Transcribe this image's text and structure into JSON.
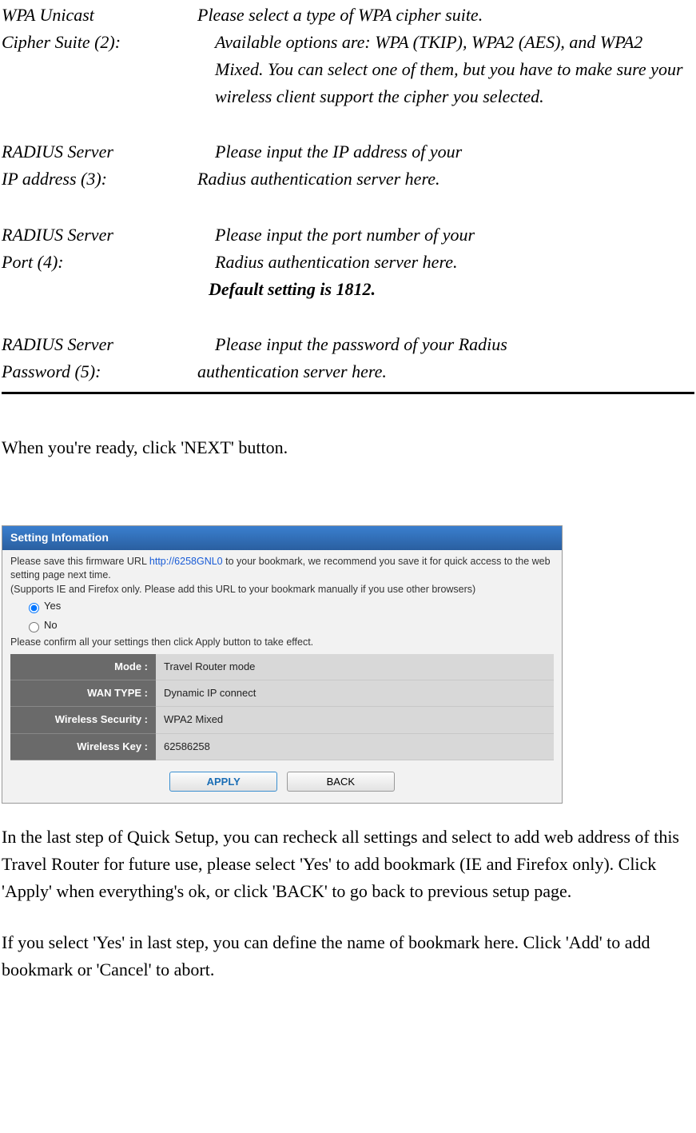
{
  "definitions": {
    "item1": {
      "term_line1": "WPA Unicast",
      "term_line2": "Cipher Suite (2):",
      "desc_line1": "Please select a type of WPA cipher suite.",
      "desc_line2": "Available options are: WPA (TKIP), WPA2 (AES), and WPA2 Mixed. You can select one of them, but you have to make sure your wireless client support the cipher you selected."
    },
    "item2": {
      "term_line1": "RADIUS Server",
      "term_line2": "IP address (3):",
      "desc_line1": "Please input the IP address of your",
      "desc_line2": "Radius authentication server here."
    },
    "item3": {
      "term_line1": "RADIUS Server",
      "term_line2": "Port (4):",
      "desc_line1": "Please input the port number of your",
      "desc_line2": "Radius authentication server here.",
      "bold_line": "Default setting is 1812."
    },
    "item4": {
      "term_line1": "RADIUS Server",
      "term_line2": "Password (5):",
      "desc_line1": "Please input the password of your Radius",
      "desc_line2": "authentication server here."
    }
  },
  "paragraphs": {
    "p1": "When you're ready, click 'NEXT' button.",
    "p2": "In the last step of Quick Setup, you can recheck all settings and select to add web address of this Travel Router for future use, please select 'Yes' to add bookmark (IE and Firefox only). Click 'Apply' when everything's ok, or click 'BACK' to go back to previous setup page.",
    "p3": "If you select 'Yes' in last step, you can define the name of bookmark here. Click 'Add' to add bookmark or 'Cancel' to abort."
  },
  "panel": {
    "title": "Setting Infomation",
    "msg_prefix": "Please save this firmware URL ",
    "url": "http://6258GNL0",
    "msg_suffix": " to your bookmark, we recommend you save it for quick access to the web setting page next time.",
    "msg_supports": "(Supports IE and Firefox only. Please add this URL to your bookmark manually if you use other browsers)",
    "option_yes": "Yes",
    "option_no": "No",
    "msg_confirm": "Please confirm all your settings then click Apply button to take effect.",
    "rows": {
      "mode_label": "Mode :",
      "mode_value": "Travel Router mode",
      "wan_label": "WAN TYPE :",
      "wan_value": "Dynamic IP connect",
      "sec_label": "Wireless Security :",
      "sec_value": "WPA2 Mixed",
      "key_label": "Wireless Key :",
      "key_value": "62586258"
    },
    "apply_btn": "APPLY",
    "back_btn": "BACK"
  }
}
